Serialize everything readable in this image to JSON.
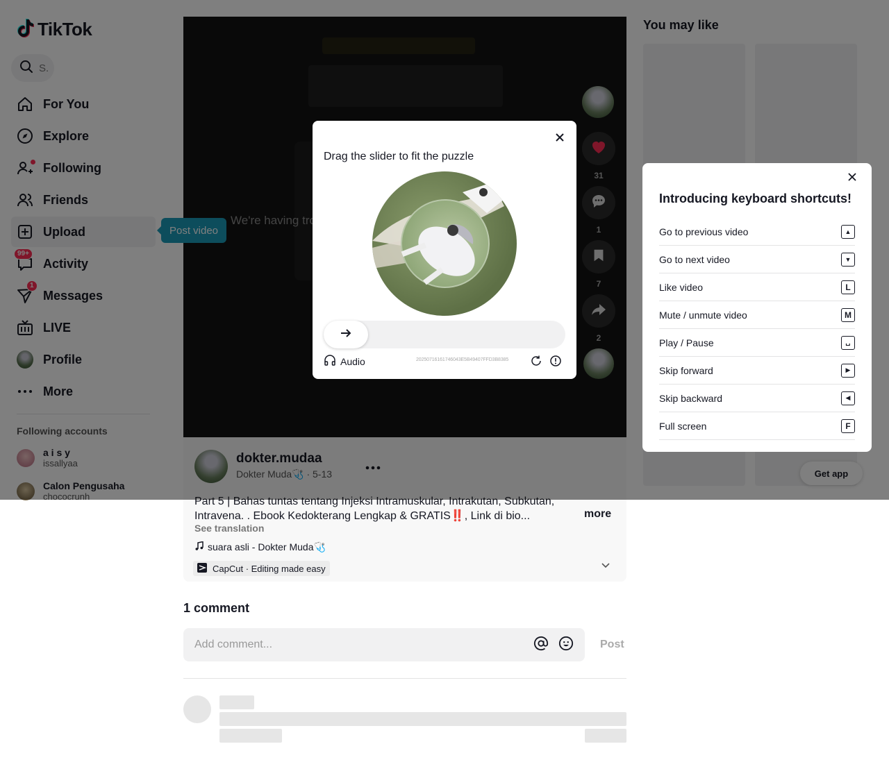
{
  "brand": {
    "name": "TikTok"
  },
  "search": {
    "placeholder": "S."
  },
  "nav": [
    {
      "label": "For You",
      "icon": "home-icon"
    },
    {
      "label": "Explore",
      "icon": "compass-icon"
    },
    {
      "label": "Following",
      "icon": "following-icon"
    },
    {
      "label": "Friends",
      "icon": "friends-icon"
    },
    {
      "label": "Upload",
      "icon": "upload-icon"
    },
    {
      "label": "Activity",
      "icon": "activity-icon",
      "badge": "99+"
    },
    {
      "label": "Messages",
      "icon": "messages-icon",
      "badge": "1"
    },
    {
      "label": "LIVE",
      "icon": "live-icon"
    },
    {
      "label": "Profile",
      "icon": "avatar"
    },
    {
      "label": "More",
      "icon": "more-icon"
    }
  ],
  "tooltip": {
    "post_video": "Post video"
  },
  "following": {
    "title": "Following accounts",
    "accounts": [
      {
        "name": "a i s y",
        "username": "issallyaa"
      },
      {
        "name": "Calon Pengusaha",
        "username": "chococrunh"
      }
    ]
  },
  "video": {
    "error_text": "We're having tro"
  },
  "actions": {
    "likes": "31",
    "comments": "1",
    "saves": "7",
    "shares": "2"
  },
  "post": {
    "author": "dokter.mudaa",
    "meta": "Dokter Muda🩺 · 5-13",
    "description": "Part 5 | Bahas tuntas tentang Injeksi Intramuskular, Intrakutan, Subkutan, Intravena. . Ebook Kedokterang Lengkap & GRATIS‼️, Link di bio...",
    "more": "more",
    "see_translation": "See translation",
    "music": "suara asli - Dokter Muda🩺",
    "capcut": "CapCut · Editing made easy"
  },
  "comments": {
    "count_label": "1 comment",
    "placeholder": "Add comment...",
    "post_label": "Post"
  },
  "right": {
    "you_may_like": "You may like",
    "get_app": "Get app"
  },
  "shortcuts": {
    "title": "Introducing keyboard shortcuts!",
    "items": [
      {
        "label": "Go to previous video",
        "key": "▲"
      },
      {
        "label": "Go to next video",
        "key": "▼"
      },
      {
        "label": "Like video",
        "key": "L"
      },
      {
        "label": "Mute / unmute video",
        "key": "M"
      },
      {
        "label": "Play / Pause",
        "key": "␣"
      },
      {
        "label": "Skip forward",
        "key": "▶"
      },
      {
        "label": "Skip backward",
        "key": "◀"
      },
      {
        "label": "Full screen",
        "key": "F"
      }
    ]
  },
  "captcha": {
    "title": "Drag the slider to fit the puzzle",
    "audio": "Audio",
    "id": "20250716161746043E5B49407FFD3B8385"
  },
  "colors": {
    "accent": "#fe2c55",
    "tooltip": "#1a9bb8"
  }
}
